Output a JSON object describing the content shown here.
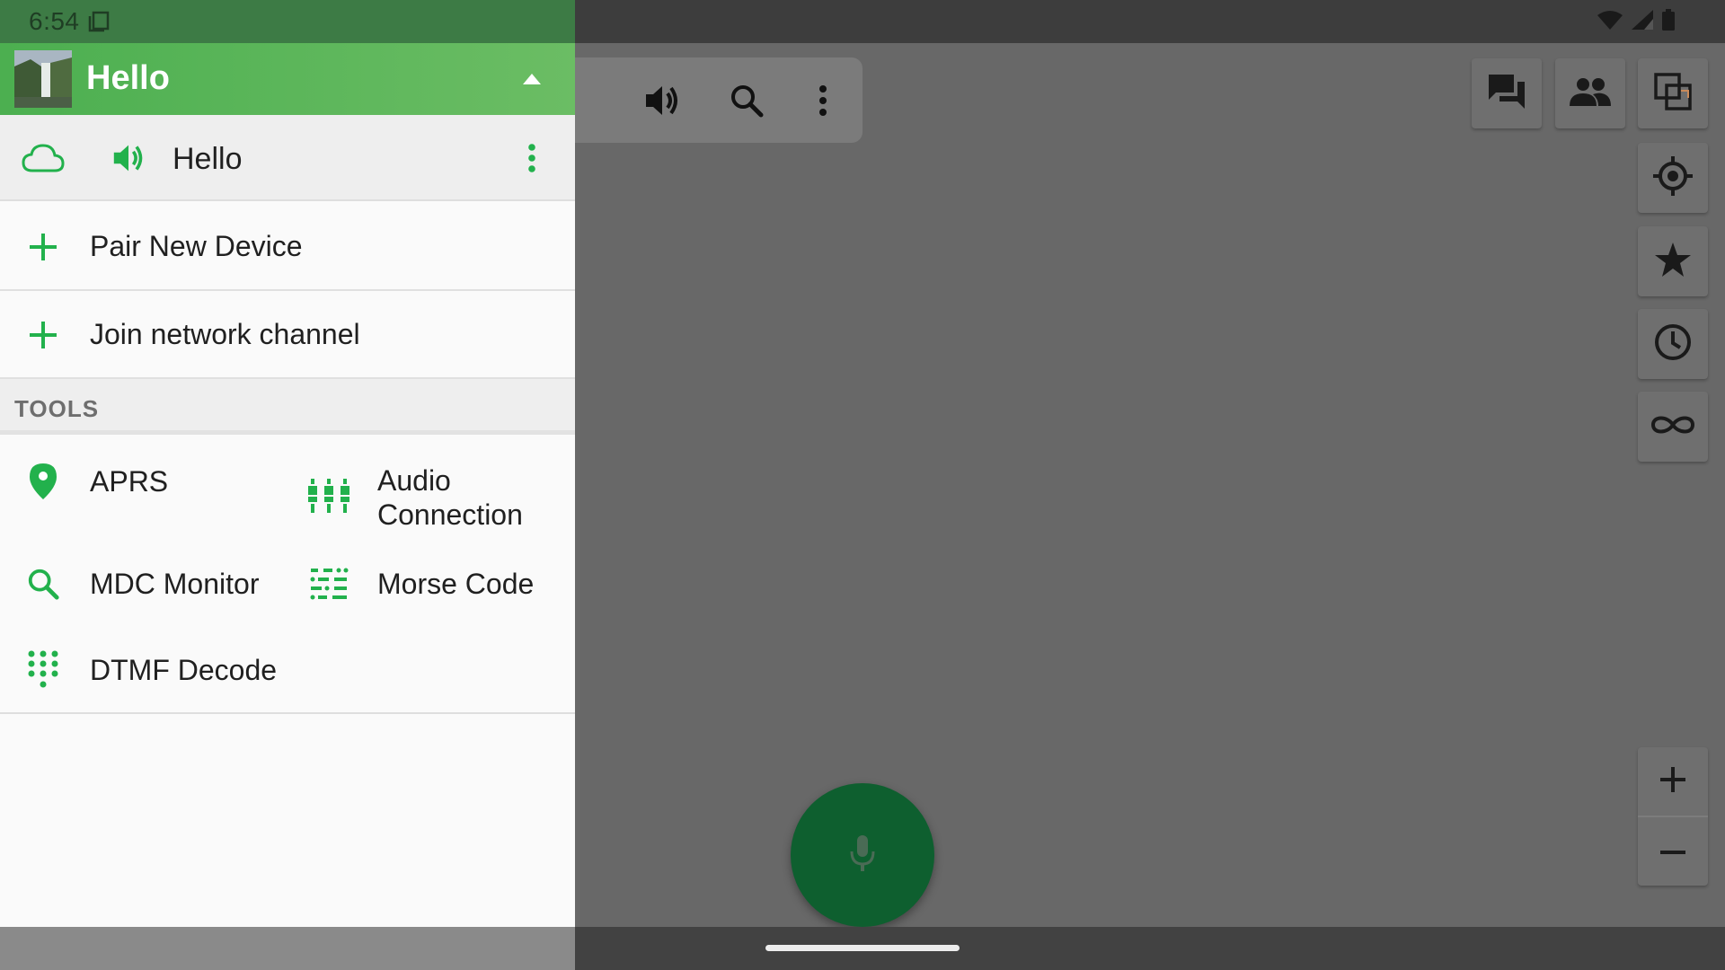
{
  "colors": {
    "accent": "#22b14c",
    "header_green": "#4caf50",
    "fab_green": "#0e5f2f",
    "scrim_gray": "#686868"
  },
  "status_bar": {
    "time": "6:54",
    "screen_icon": "screenshot-icon",
    "wifi_icon": "wifi-icon",
    "signal_icon": "cell-signal-icon",
    "battery_icon": "battery-icon"
  },
  "drawer": {
    "header": {
      "title": "Hello",
      "avatar_icon": "waterfall-avatar",
      "toggle_icon": "arrow-up-icon"
    },
    "channel": {
      "status_icon": "cloud-icon",
      "audio_icon": "volume-icon",
      "name": "Hello",
      "menu_icon": "more-vert-icon"
    },
    "actions": [
      {
        "label": "Pair New Device",
        "icon": "plus-icon"
      },
      {
        "label": "Join network channel",
        "icon": "plus-icon"
      }
    ],
    "tools_title": "TOOLS",
    "tools": [
      {
        "label": "APRS",
        "icon": "location-pin-icon"
      },
      {
        "label": "Audio Connection",
        "icon": "equalizer-icon"
      },
      {
        "label": "MDC Monitor",
        "icon": "search-icon"
      },
      {
        "label": "Morse Code",
        "icon": "morse-code-icon"
      },
      {
        "label": "DTMF Decode",
        "icon": "dialpad-icon"
      }
    ]
  },
  "toolbar": {
    "volume_icon": "volume-icon",
    "search_icon": "search-icon",
    "menu_icon": "more-vert-icon"
  },
  "map_controls": {
    "buttons": [
      "chat-icon",
      "people-icon",
      "layers-icon",
      "my-location-icon",
      "star-icon",
      "history-icon",
      "infinity-icon"
    ],
    "zoom_in_icon": "plus-icon",
    "zoom_out_icon": "minus-icon"
  },
  "ptt_button": {
    "icon": "microphone-icon"
  }
}
